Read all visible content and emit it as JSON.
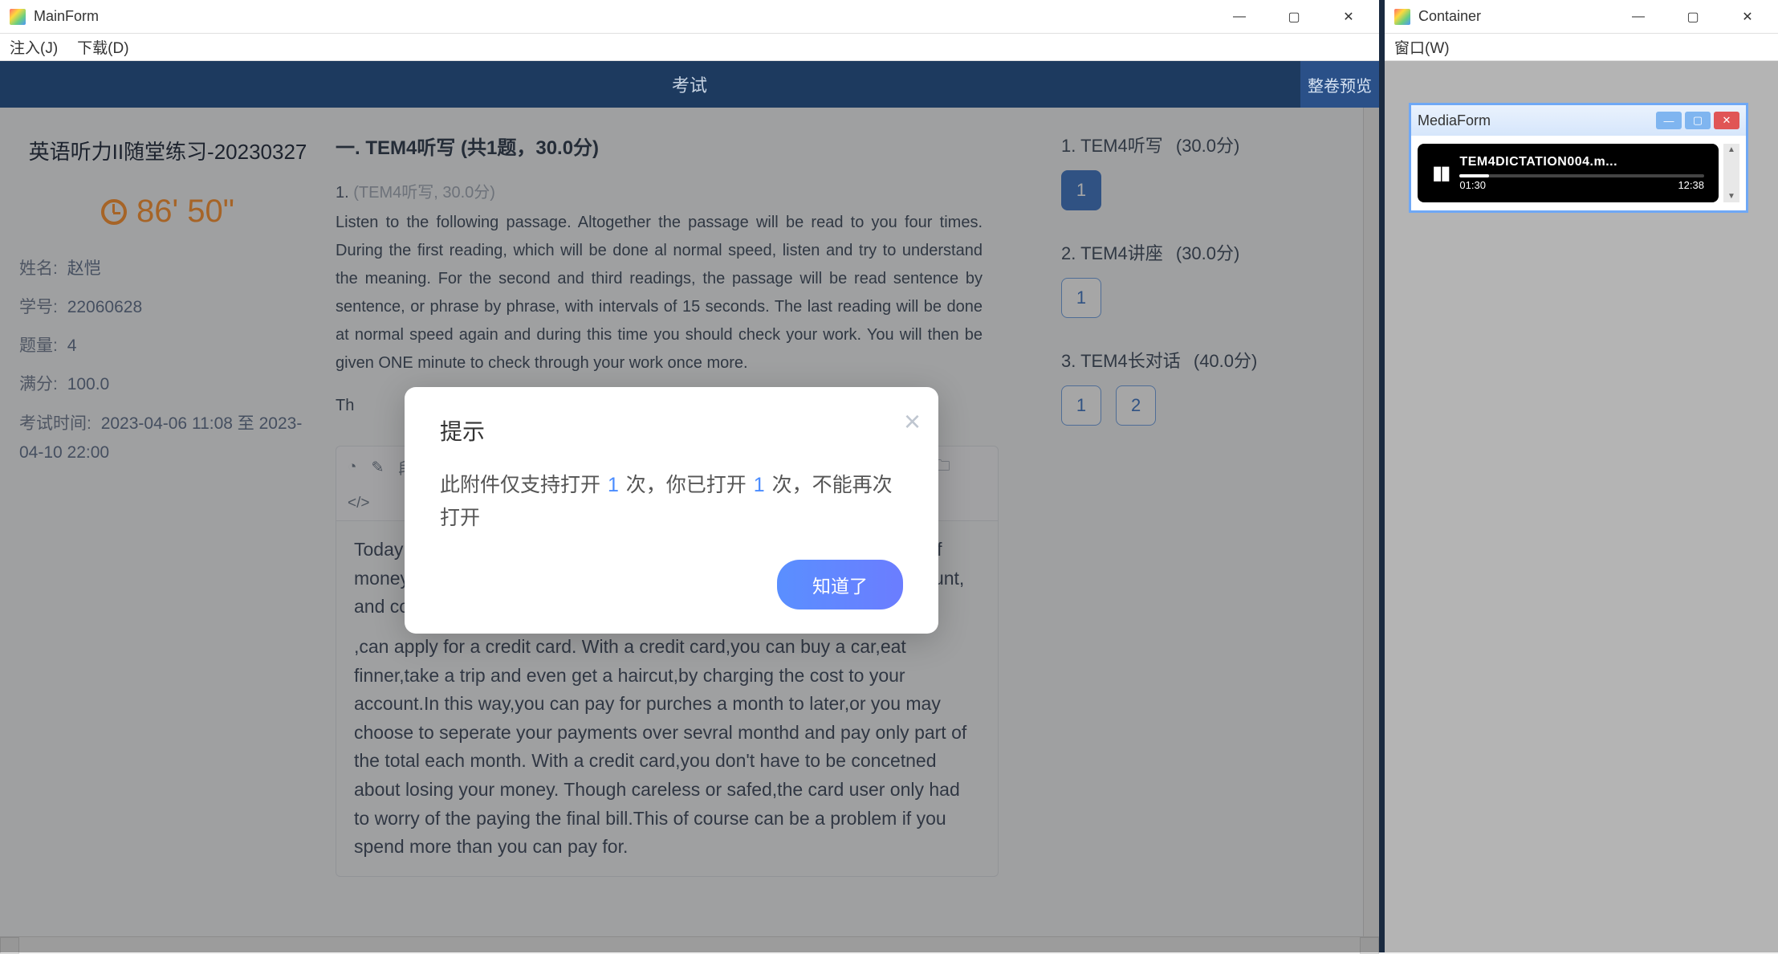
{
  "main_window": {
    "title": "MainForm",
    "menu": {
      "inject": "注入(J)",
      "download": "下载(D)"
    },
    "topbar": {
      "center": "考试",
      "preview": "整卷预览"
    }
  },
  "left": {
    "exam_title": "英语听力II随堂练习-20230327",
    "timer": "86' 50\"",
    "name_label": "姓名:",
    "name_value": "赵恺",
    "id_label": "学号:",
    "id_value": "22060628",
    "qcount_label": "题量:",
    "qcount_value": "4",
    "total_label": "满分:",
    "total_value": "100.0",
    "time_label": "考试时间:",
    "time_value": "2023-04-06 11:08 至 2023-04-10 22:00"
  },
  "middle": {
    "section_title": "一. TEM4听写   (共1题，30.0分)",
    "q_meta_num": "1.",
    "q_meta_desc": "(TEM4听写, 30.0分)",
    "passage": "Listen to the following passage. Altogether the passage will be read to you four times. During the first reading, which will be done al normal speed, listen and try to understand the meaning. For the second and third readings, the passage will be read sentence by sentence, or phrase by phrase, with intervals of 15 seconds. The last reading will be done at normal speed again and during this time you should check your work. You will then be given ONE minute to check through your work once more.",
    "th_line": "Th",
    "toolbar": {
      "para": "段落格式",
      "font": "字体",
      "size": "字号"
    },
    "editor_p1": "Today more and more people in the US are using credit cards,instead of money, to buy what they need. Alomost anyone who has a steady account, and continues to work _____",
    "editor_p2": ",can apply for a credit card. With a credit card,you can buy a car,eat finner,take a trip and even get a haircut,by charging the cost to your account.In this way,you can pay for purches a month to later,or you may choose to seperate your payments over sevral monthd and pay only part of the total each month. With a credit card,you don't have to be concetned about losing your money. Though careless or safed,the card user only had to worry of the paying the final bill.This of course can be a problem if you spend more than you can pay for."
  },
  "right": {
    "sections": [
      {
        "title": "1. TEM4听写",
        "points": "(30.0分)",
        "questions": [
          "1"
        ],
        "active": 0
      },
      {
        "title": "2. TEM4讲座",
        "points": "(30.0分)",
        "questions": [
          "1"
        ],
        "active": -1
      },
      {
        "title": "3. TEM4长对话",
        "points": "(40.0分)",
        "questions": [
          "1",
          "2"
        ],
        "active": -1
      }
    ]
  },
  "modal": {
    "title": "提示",
    "body_pre": "此附件仅支持打开 ",
    "body_n1": "1",
    "body_mid": " 次，你已打开 ",
    "body_n2": "1",
    "body_post": " 次，不能再次打开",
    "ok": "知道了"
  },
  "container_window": {
    "title": "Container",
    "menu": {
      "window": "窗口(W)"
    }
  },
  "media": {
    "title": "MediaForm",
    "track": "TEM4DICTATION004.m...",
    "elapsed": "01:30",
    "total": "12:38"
  }
}
